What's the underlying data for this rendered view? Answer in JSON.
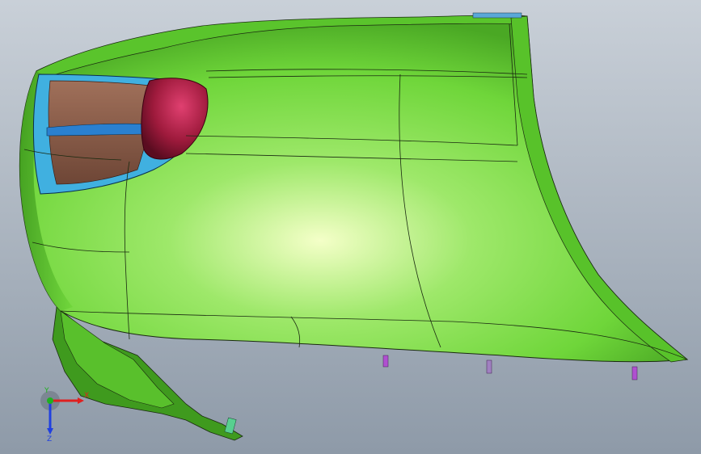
{
  "viewport": {
    "background_top": "#c9d0d8",
    "background_bottom": "#8e9aa8",
    "model_color": "#6fd63a",
    "model_highlight": "#f4ffc8",
    "model_shadow": "#3f9a1e",
    "edge_color": "#1a2a10",
    "lamp_housing_color": "#9e1a3c",
    "lamp_inner_color": "#8a5a48",
    "lamp_ring_color": "#40b0e0"
  },
  "triad": {
    "x_label": "X",
    "y_label": "Y",
    "z_label": "Z",
    "x_color": "#e02020",
    "y_color": "#20b020",
    "z_color": "#2040e0"
  },
  "features": {
    "mount_pin_color": "#b050d0",
    "mount_pin_alt_color": "#a080c0",
    "bracket_color": "#58d090"
  }
}
